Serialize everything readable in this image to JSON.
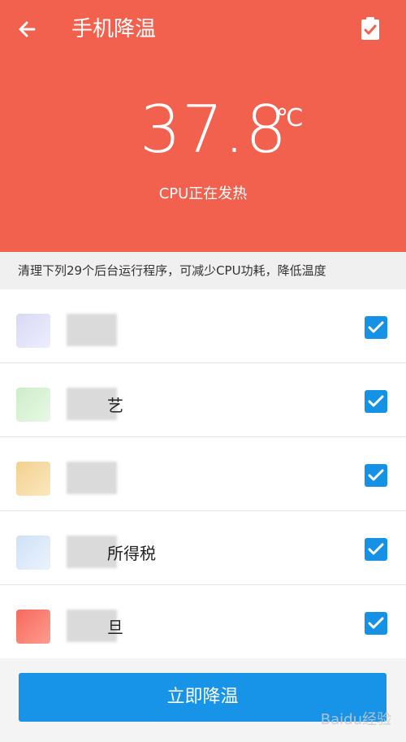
{
  "header": {
    "title": "手机降温",
    "temperature": "37.8",
    "unit": "℃",
    "status": "CPU正在发热",
    "background": "#f2604e"
  },
  "note": "清理下列29个后台运行程序，可减少CPU功耗，降低温度",
  "apps": [
    {
      "name_visible": "",
      "checked": true,
      "icon_colors": [
        "#d9d9ee",
        "#e6e6ff"
      ]
    },
    {
      "name_visible": "艺",
      "checked": true,
      "icon_colors": [
        "#c8f0c3",
        "#d9f7d7"
      ]
    },
    {
      "name_visible": "",
      "checked": true,
      "icon_colors": [
        "#f0ce8e",
        "#f7e3b5"
      ]
    },
    {
      "name_visible": "所得税",
      "checked": true,
      "icon_colors": [
        "#cfe1f6",
        "#e6f0fb"
      ]
    },
    {
      "name_visible": "旦",
      "checked": true,
      "icon_colors": [
        "#f56a5b",
        "#ff8a7d"
      ]
    }
  ],
  "button_label": "立即降温",
  "watermark": "Baidu经验",
  "accent": "#1592e6"
}
